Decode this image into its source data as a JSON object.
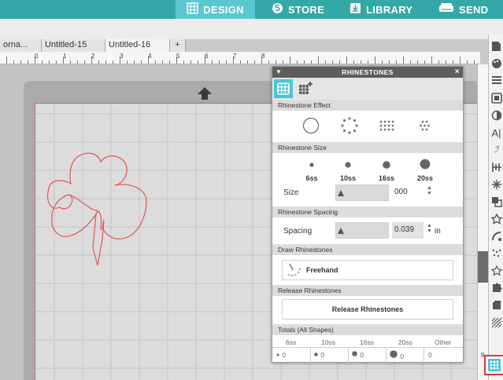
{
  "nav": {
    "design": "DESIGN",
    "store": "STORE",
    "library": "LIBRARY",
    "send": "SEND"
  },
  "doc_tabs": [
    "orna...",
    "Untitled-15",
    "Untitled-16"
  ],
  "add_tab": "+",
  "ruler_numbers": [
    "0",
    "1",
    "2",
    "3",
    "4",
    "5",
    "6",
    "7",
    "8"
  ],
  "panel": {
    "title": "RHINESTONES",
    "collapse_icon": "chevron-down-icon",
    "close": "×",
    "effect": {
      "header": "Rhinestone Effect"
    },
    "size": {
      "header": "Rhinestone Size",
      "options": [
        "6ss",
        "10ss",
        "16ss",
        "20ss"
      ],
      "label": "Size",
      "value": "000"
    },
    "spacing": {
      "header": "Rhinestone Spacing",
      "label": "Spacing",
      "value": "0.039",
      "unit": "in"
    },
    "draw": {
      "header": "Draw Rhinestones",
      "freehand": "Freehand"
    },
    "release": {
      "header": "Release Rhinestones",
      "button": "Release Rhinestones"
    },
    "totals": {
      "header": "Totals (All Shapes)",
      "columns": [
        "6ss",
        "10ss",
        "16ss",
        "20ss",
        "Other"
      ],
      "values": [
        "0",
        "0",
        "0",
        "0",
        "0"
      ]
    }
  },
  "right_ruler": [
    "8",
    "9"
  ],
  "colors": {
    "accent": "#34a8a6",
    "active_tab": "#5ac8cf",
    "panel_tab_active": "#4fc3d6",
    "cut_line": "#e06060"
  }
}
